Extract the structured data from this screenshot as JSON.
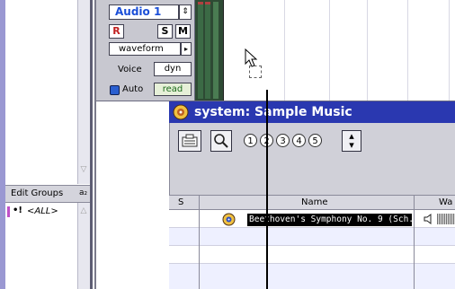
{
  "track": {
    "name": "Audio 1",
    "name_arrows": "⇕",
    "rec_label": "R",
    "solo_label": "S",
    "mute_label": "M",
    "view": "waveform",
    "view_arrow": "▸",
    "voice_label": "Voice",
    "voice_value": "dyn",
    "auto_label": "Auto",
    "auto_mode": "read"
  },
  "edit_groups": {
    "title": "Edit Groups",
    "sort_glyph": "a₂",
    "items": [
      {
        "marker": "•!",
        "label": "<ALL>"
      }
    ]
  },
  "browser": {
    "title": "system: Sample Music",
    "pages": [
      "1",
      "2",
      "3",
      "4",
      "5"
    ],
    "updown_glyph": "▴\n▾",
    "columns": [
      "S",
      "Name",
      "Wa"
    ],
    "rows": [
      {
        "name": "Beethoven's Symphony No. 9 (Sch."
      }
    ]
  },
  "colors": {
    "title_bar": "#2a38b0",
    "track_name": "#1a4ed8",
    "left_panel": "#9a98d2",
    "edit_group_color": "#c050c8"
  }
}
